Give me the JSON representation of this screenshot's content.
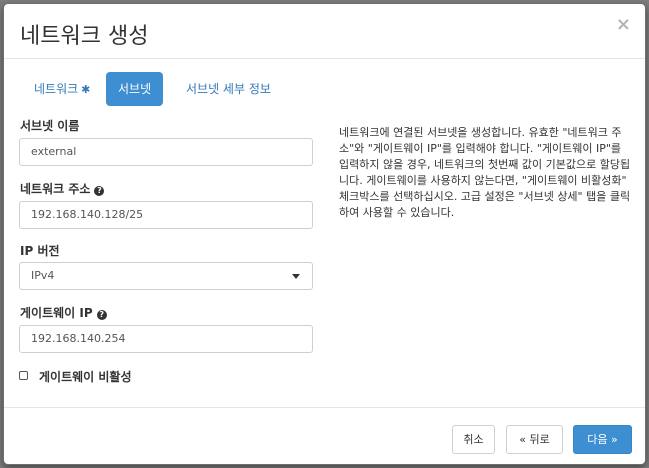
{
  "dialog": {
    "title": "네트워크 생성",
    "close_glyph": "×"
  },
  "tabs": [
    {
      "label": "네트워크",
      "required": "✱"
    },
    {
      "label": "서브넷"
    },
    {
      "label": "서브넷 세부 정보"
    }
  ],
  "form": {
    "subnet_name": {
      "label": "서브넷 이름",
      "value": "external"
    },
    "network_address": {
      "label": "네트워크 주소",
      "help": "?",
      "value": "192.168.140.128/25"
    },
    "ip_version": {
      "label": "IP 버전",
      "value": "IPv4"
    },
    "gateway_ip": {
      "label": "게이트웨이 IP",
      "help": "?",
      "value": "192.168.140.254"
    },
    "disable_gateway": {
      "label": "게이트웨이 비활성",
      "checked": false
    }
  },
  "description": "네트워크에 연결된 서브넷을 생성합니다. 유효한 \"네트워크 주소\"와 \"게이트웨이 IP\"를 입력해야 합니다. \"게이트웨이 IP\"를 입력하지 않을 경우, 네트워크의 첫번째 값이 기본값으로 할당됩니다. 게이트웨이를 사용하지 않는다면, \"게이트웨이 비활성화\" 체크박스를 선택하십시오. 고급 설정은 \"서브넷 상세\" 탭을 클릭하여 사용할 수 있습니다.",
  "footer": {
    "cancel": "취소",
    "back": "« 뒤로",
    "next": "다음 »"
  },
  "colors": {
    "primary": "#3d8fd1",
    "link": "#337ab7"
  }
}
